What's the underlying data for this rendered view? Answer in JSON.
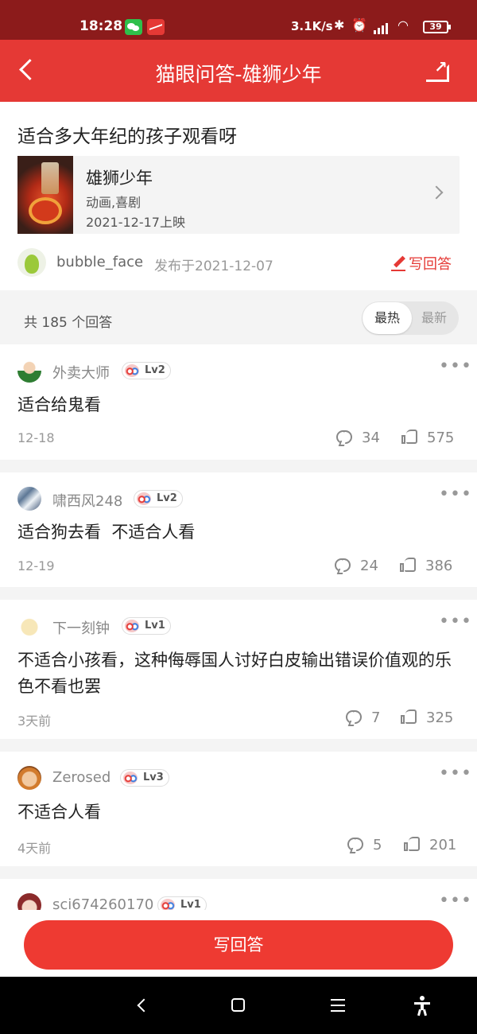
{
  "status_bar": {
    "time": "18:28",
    "network_speed": "3.1K/s",
    "battery": "39",
    "icons": [
      "wechat-icon",
      "stock-app-icon",
      "bluetooth-icon",
      "alarm-icon",
      "signal-icon",
      "wifi-icon",
      "battery-icon"
    ]
  },
  "header": {
    "title": "猫眼问答-雄狮少年",
    "back_icon": "chevron-left-icon",
    "share_icon": "share-icon"
  },
  "question": {
    "title": "适合多大年纪的孩子观看呀",
    "movie": {
      "name": "雄狮少年",
      "genre": "动画,喜剧",
      "release": "2021-12-17上映"
    },
    "asker": {
      "name": "bubble_face",
      "posted": "发布于2021-12-07"
    },
    "write_link": "写回答"
  },
  "answers_header": {
    "count_text": "共 185 个回答",
    "sort_hot": "最热",
    "sort_new": "最新",
    "active_sort": "最热"
  },
  "answers": [
    {
      "user": "外卖大师",
      "level": "Lv2",
      "text": "适合给鬼看",
      "date": "12-18",
      "comments": "34",
      "likes": "575"
    },
    {
      "user": "啸西风248",
      "level": "Lv2",
      "text": "适合狗去看  不适合人看",
      "date": "12-19",
      "comments": "24",
      "likes": "386"
    },
    {
      "user": "下一刻钟",
      "level": "Lv1",
      "text": "不适合小孩看，这种侮辱国人讨好白皮输出错误价值观的乐色不看也罢",
      "date": "3天前",
      "comments": "7",
      "likes": "325"
    },
    {
      "user": "Zerosed",
      "level": "Lv3",
      "text": "不适合人看",
      "date": "4天前",
      "comments": "5",
      "likes": "201"
    },
    {
      "user": "sci674260170",
      "level": "Lv1"
    }
  ],
  "footer": {
    "write_button": "写回答"
  },
  "colors": {
    "brand_red": "#e53935",
    "status_bar": "#8c1b1b",
    "button_red": "#ee3a32"
  }
}
